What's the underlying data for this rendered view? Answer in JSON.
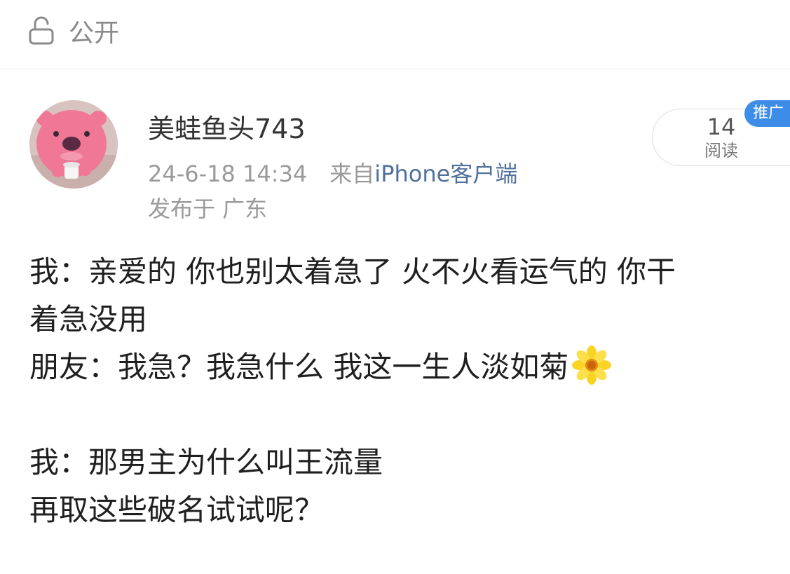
{
  "visibility": {
    "icon": "lock-icon",
    "label": "公开"
  },
  "post": {
    "author": "美蛙鱼头743",
    "avatar_icon": "pink-beaver-avatar",
    "timestamp": "24-6-18 14:34",
    "source_prefix": "来自",
    "source": "iPhone客户端",
    "location": "发布于 广东",
    "read_count": "14",
    "read_label": "阅读",
    "promo_badge": "推广",
    "lines": [
      "我：亲爱的 你也别太着急了 火不火看运气的 你干",
      "着急没用",
      "朋友：我急？我急什么 我这一生人淡如菊",
      "",
      "我：那男主为什么叫王流量",
      "再取这些破名试试呢？"
    ],
    "emoji_icon": "sunflower-emoji-icon"
  },
  "colors": {
    "link": "#51709c",
    "badge": "#3d8ce8",
    "meta": "#9a9a9a",
    "text": "#1f1f1f"
  }
}
